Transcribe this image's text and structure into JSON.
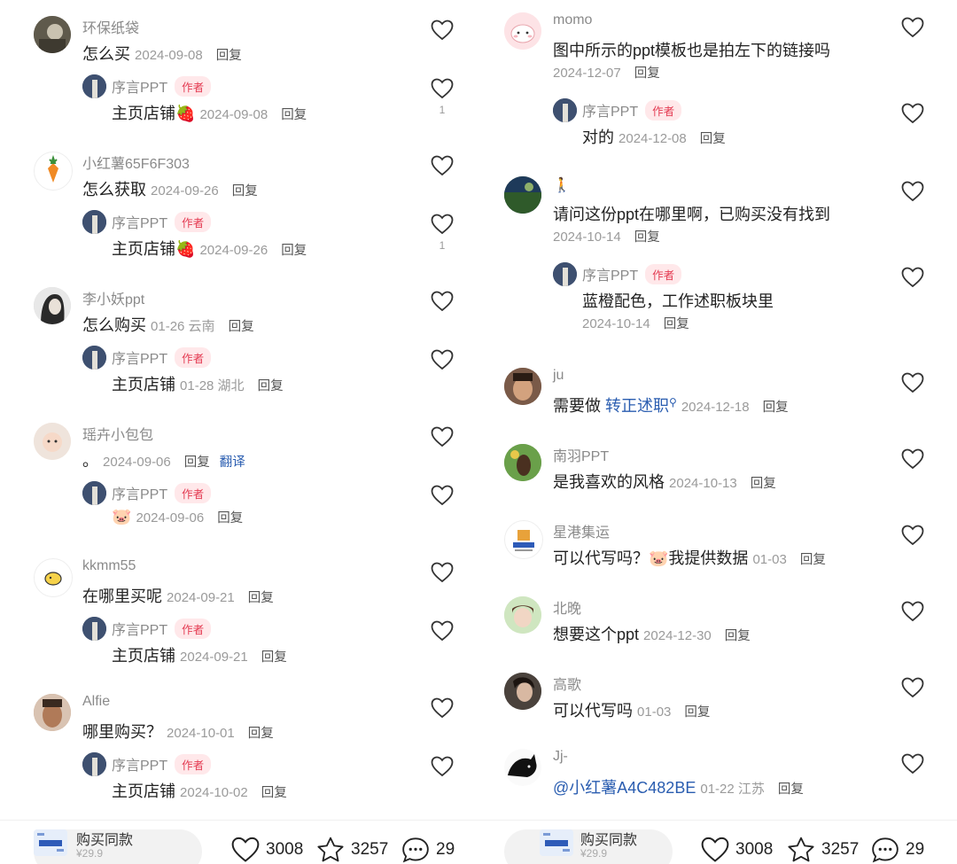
{
  "left": {
    "comments": [
      {
        "user": "环保纸袋",
        "text": "怎么买",
        "date": "2024-09-08",
        "reply": "回复",
        "sub": {
          "user": "序言PPT",
          "tag": "作者",
          "text": "主页店铺🍓",
          "date": "2024-09-08",
          "reply": "回复",
          "likes": "1"
        }
      },
      {
        "user": "小红薯65F6F303",
        "text": "怎么获取",
        "date": "2024-09-26",
        "reply": "回复",
        "sub": {
          "user": "序言PPT",
          "tag": "作者",
          "text": "主页店铺🍓",
          "date": "2024-09-26",
          "reply": "回复",
          "likes": "1"
        }
      },
      {
        "user": "李小妖ppt",
        "text": "怎么购买",
        "date": "01-26 云南",
        "reply": "回复",
        "sub": {
          "user": "序言PPT",
          "tag": "作者",
          "text": "主页店铺",
          "date": "01-28 湖北",
          "reply": "回复"
        }
      },
      {
        "user": "瑶卉小包包",
        "text": "。",
        "date": "2024-09-06",
        "reply": "回复",
        "translate": "翻译",
        "sub": {
          "user": "序言PPT",
          "tag": "作者",
          "text": "🐷",
          "date": "2024-09-06",
          "reply": "回复"
        }
      },
      {
        "user": "kkmm55",
        "text": "在哪里买呢",
        "date": "2024-09-21",
        "reply": "回复",
        "sub": {
          "user": "序言PPT",
          "tag": "作者",
          "text": "主页店铺",
          "date": "2024-09-21",
          "reply": "回复"
        }
      },
      {
        "user": "Alfie",
        "text": "哪里购买？",
        "date": "2024-10-01",
        "reply": "回复",
        "sub": {
          "user": "序言PPT",
          "tag": "作者",
          "text": "主页店铺",
          "date": "2024-10-02",
          "reply": "回复"
        }
      }
    ],
    "bar": {
      "buy_label": "购买同款",
      "price": "¥29.9",
      "likes": "3008",
      "stars": "3257",
      "comments": "29"
    }
  },
  "right": {
    "c1": {
      "user": "momo",
      "text": "图中所示的ppt模板也是拍左下的链接吗",
      "date": "2024-12-07",
      "reply": "回复",
      "sub": {
        "user": "序言PPT",
        "tag": "作者",
        "text": "对的",
        "date": "2024-12-08",
        "reply": "回复"
      }
    },
    "c2": {
      "user": "🚶",
      "text": "请问这份ppt在哪里啊，已购买没有找到",
      "date": "2024-10-14",
      "reply": "回复",
      "sub": {
        "user": "序言PPT",
        "tag": "作者",
        "text": "蓝橙配色，工作述职板块里",
        "date": "2024-10-14",
        "reply": "回复"
      }
    },
    "c3": {
      "user": "ju",
      "text": "需要做",
      "link": "转正述职",
      "date": "2024-12-18",
      "reply": "回复"
    },
    "c4": {
      "user": "南羽PPT",
      "text": "是我喜欢的风格",
      "date": "2024-10-13",
      "reply": "回复"
    },
    "c5": {
      "user": "星港集运",
      "text": "可以代写吗？🐷我提供数据",
      "date": "01-03",
      "reply": "回复"
    },
    "c6": {
      "user": "北晚",
      "text": "想要这个ppt",
      "date": "2024-12-30",
      "reply": "回复"
    },
    "c7": {
      "user": "高歌",
      "text": "可以代写吗",
      "date": "01-03",
      "reply": "回复"
    },
    "c8": {
      "user": "Jj-",
      "text": "@小红薯A4C482BE",
      "date": "01-22 江苏",
      "reply": "回复"
    },
    "bar": {
      "buy_label": "购买同款",
      "price": "¥29.9",
      "likes": "3008",
      "stars": "3257",
      "comments": "29"
    }
  },
  "colors": {
    "tag_bg": "#ffe8ea",
    "tag_text": "#e43b52",
    "link": "#2a5db0",
    "meta": "#9a9a9a"
  }
}
